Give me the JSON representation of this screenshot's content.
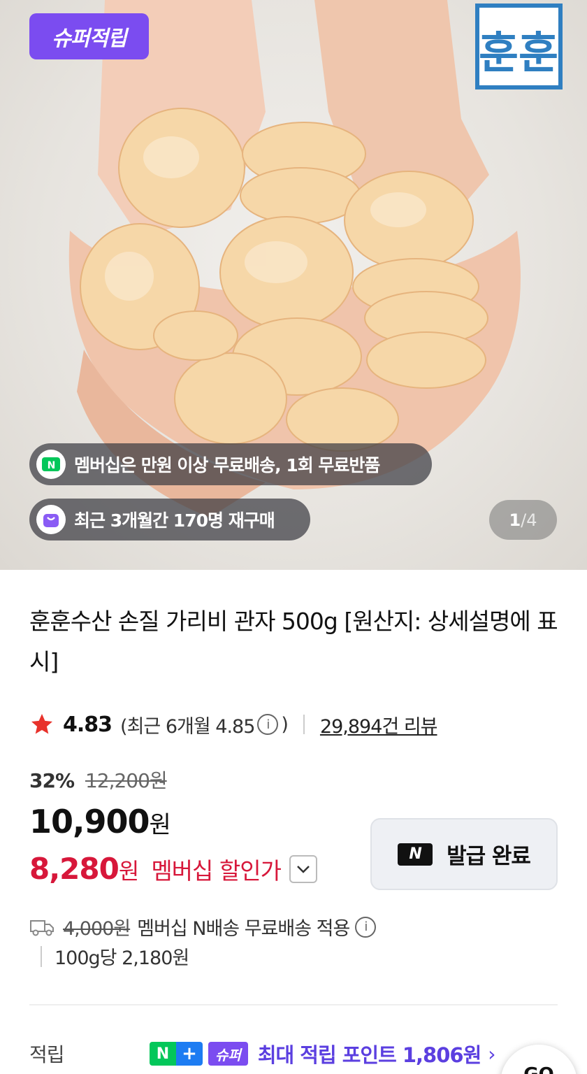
{
  "hero": {
    "super_badge": "슈퍼적립",
    "brand_logo": "훈훈",
    "membership_pill": "멤버십은 만원 이상 무료배송, 1회 무료반품",
    "repurchase_pill": "최근 3개월간 170명 재구매",
    "pager": {
      "current": "1",
      "separator": "/",
      "total": "4"
    }
  },
  "product": {
    "title": "훈훈수산 손질 가리비 관자 500g [원산지: 상세설명에 표시]",
    "rating": "4.83",
    "recent_rating_prefix": "(최근 6개월 4.85",
    "recent_rating_suffix": ")",
    "info_glyph": "i",
    "reviews": "29,894건 리뷰"
  },
  "price": {
    "discount_pct": "32%",
    "original_price": "12,200원",
    "sale_amount": "10,900",
    "currency": "원",
    "member_amount": "8,280",
    "member_label": "멤버십 할인가",
    "coupon_button": "발급 완료",
    "coupon_logo": "N"
  },
  "shipping": {
    "original_fee": "4,000원",
    "text": "멤버십 N배송 무료배송 적용",
    "unit_price": "100g당 2,180원"
  },
  "points": {
    "label": "적립",
    "n_badge": "N",
    "plus_badge": "+",
    "super_badge": "슈퍼",
    "text": "최대 적립 포인트 1,806원",
    "chevron": "›"
  },
  "floating_button": "GO",
  "icons": {
    "star": "star-icon",
    "info": "info-icon",
    "truck": "truck-icon",
    "chevron": "chevron-down-icon",
    "membership": "naver-membership-icon",
    "repurchase": "shopping-bag-icon"
  },
  "colors": {
    "super_purple": "#7b4cf0",
    "member_red": "#d7173a",
    "star_red": "#e8322b",
    "naver_green": "#03c75a",
    "brand_blue": "#2f7fc1"
  }
}
